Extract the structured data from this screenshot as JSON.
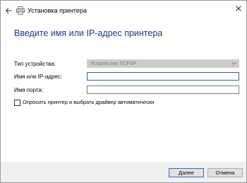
{
  "window": {
    "title": "Установка принтера"
  },
  "main": {
    "heading": "Введите имя или IP-адрес принтера",
    "device_type": {
      "label": "Тип устройства:",
      "value": "Устройство TCP/IP"
    },
    "hostname": {
      "label": "Имя или IP-адрес:",
      "value": ""
    },
    "port_name": {
      "label": "Имя порта:",
      "value": ""
    },
    "auto_driver": {
      "label": "Опросить принтер и выбрать драйвер автоматически",
      "checked": false
    }
  },
  "footer": {
    "next_label": "Далее",
    "cancel_label": "Отмена"
  },
  "icons": {
    "back": "back-arrow-icon",
    "title": "printer-icon",
    "close": "close-icon",
    "dropdown": "chevron-down-icon"
  },
  "colors": {
    "heading": "#1a3a8f",
    "focus_border": "#2a5fb0",
    "footer_bg": "#f0f0f0"
  }
}
